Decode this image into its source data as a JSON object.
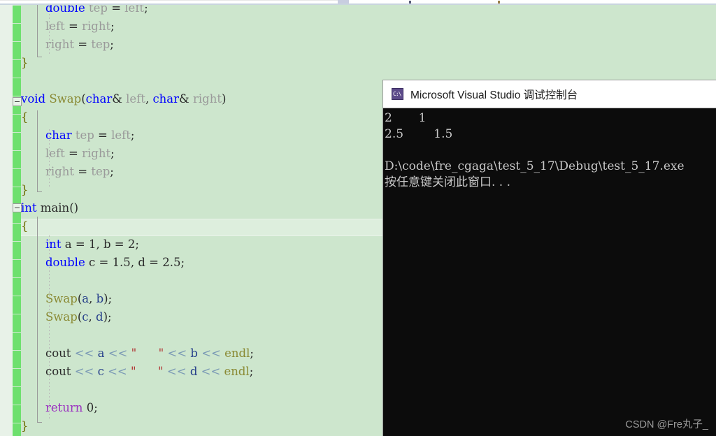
{
  "window": {
    "editor": {
      "background_color": "#cde6cd",
      "change_bar_color": "#6ee06e",
      "current_line_background": "#ddeedd"
    },
    "code_lines": [
      {
        "indent": 2,
        "tokens": [
          {
            "t": "double",
            "c": "typ"
          },
          {
            "t": " ",
            "c": "id"
          },
          {
            "t": "tep",
            "c": "var"
          },
          {
            "t": " ",
            "c": "id"
          },
          {
            "t": "=",
            "c": "pun"
          },
          {
            "t": " ",
            "c": "id"
          },
          {
            "t": "left",
            "c": "var"
          },
          {
            "t": ";",
            "c": "pun"
          }
        ]
      },
      {
        "indent": 2,
        "tokens": [
          {
            "t": "left",
            "c": "var"
          },
          {
            "t": " = ",
            "c": "pun"
          },
          {
            "t": "right",
            "c": "var"
          },
          {
            "t": ";",
            "c": "pun"
          }
        ]
      },
      {
        "indent": 2,
        "tokens": [
          {
            "t": "right",
            "c": "var"
          },
          {
            "t": " = ",
            "c": "pun"
          },
          {
            "t": "tep",
            "c": "var"
          },
          {
            "t": ";",
            "c": "pun"
          }
        ]
      },
      {
        "indent": 0,
        "tokens": [
          {
            "t": "}",
            "c": "brace"
          }
        ]
      },
      {
        "indent": 0,
        "tokens": []
      },
      {
        "indent": 0,
        "tokens": [
          {
            "t": "void",
            "c": "kw"
          },
          {
            "t": " ",
            "c": "id"
          },
          {
            "t": "Swap",
            "c": "fn"
          },
          {
            "t": "(",
            "c": "pun"
          },
          {
            "t": "char",
            "c": "typ"
          },
          {
            "t": "&",
            "c": "pun"
          },
          {
            "t": " ",
            "c": "id"
          },
          {
            "t": "left",
            "c": "var"
          },
          {
            "t": ", ",
            "c": "pun"
          },
          {
            "t": "char",
            "c": "typ"
          },
          {
            "t": "&",
            "c": "pun"
          },
          {
            "t": " ",
            "c": "id"
          },
          {
            "t": "right",
            "c": "var"
          },
          {
            "t": ")",
            "c": "pun"
          }
        ]
      },
      {
        "indent": 0,
        "tokens": [
          {
            "t": "{",
            "c": "brace"
          }
        ]
      },
      {
        "indent": 2,
        "tokens": [
          {
            "t": "char",
            "c": "typ"
          },
          {
            "t": " ",
            "c": "id"
          },
          {
            "t": "tep",
            "c": "var"
          },
          {
            "t": " = ",
            "c": "pun"
          },
          {
            "t": "left",
            "c": "var"
          },
          {
            "t": ";",
            "c": "pun"
          }
        ]
      },
      {
        "indent": 2,
        "tokens": [
          {
            "t": "left",
            "c": "var"
          },
          {
            "t": " = ",
            "c": "pun"
          },
          {
            "t": "right",
            "c": "var"
          },
          {
            "t": ";",
            "c": "pun"
          }
        ]
      },
      {
        "indent": 2,
        "tokens": [
          {
            "t": "right",
            "c": "var"
          },
          {
            "t": " = ",
            "c": "pun"
          },
          {
            "t": "tep",
            "c": "var"
          },
          {
            "t": ";",
            "c": "pun"
          }
        ]
      },
      {
        "indent": 0,
        "tokens": [
          {
            "t": "}",
            "c": "brace"
          }
        ]
      },
      {
        "indent": 0,
        "tokens": [
          {
            "t": "int",
            "c": "kw"
          },
          {
            "t": " ",
            "c": "id"
          },
          {
            "t": "main",
            "c": "id"
          },
          {
            "t": "()",
            "c": "pun"
          }
        ]
      },
      {
        "indent": 0,
        "tokens": [
          {
            "t": "{",
            "c": "brace"
          }
        ]
      },
      {
        "indent": 2,
        "tokens": [
          {
            "t": "int",
            "c": "typ"
          },
          {
            "t": " ",
            "c": "id"
          },
          {
            "t": "a",
            "c": "id"
          },
          {
            "t": " = ",
            "c": "pun"
          },
          {
            "t": "1",
            "c": "num"
          },
          {
            "t": ", ",
            "c": "pun"
          },
          {
            "t": "b",
            "c": "id"
          },
          {
            "t": " = ",
            "c": "pun"
          },
          {
            "t": "2",
            "c": "num"
          },
          {
            "t": ";",
            "c": "pun"
          }
        ]
      },
      {
        "indent": 2,
        "tokens": [
          {
            "t": "double",
            "c": "typ"
          },
          {
            "t": " ",
            "c": "id"
          },
          {
            "t": "c",
            "c": "id"
          },
          {
            "t": " = ",
            "c": "pun"
          },
          {
            "t": "1.5",
            "c": "num"
          },
          {
            "t": ", ",
            "c": "pun"
          },
          {
            "t": "d",
            "c": "id"
          },
          {
            "t": " = ",
            "c": "pun"
          },
          {
            "t": "2.5",
            "c": "num"
          },
          {
            "t": ";",
            "c": "pun"
          }
        ]
      },
      {
        "indent": 0,
        "tokens": []
      },
      {
        "indent": 2,
        "tokens": [
          {
            "t": "Swap",
            "c": "fn"
          },
          {
            "t": "(",
            "c": "pun"
          },
          {
            "t": "a",
            "c": "varb"
          },
          {
            "t": ", ",
            "c": "pun"
          },
          {
            "t": "b",
            "c": "varb"
          },
          {
            "t": ");",
            "c": "pun"
          }
        ]
      },
      {
        "indent": 2,
        "tokens": [
          {
            "t": "Swap",
            "c": "fn"
          },
          {
            "t": "(",
            "c": "pun"
          },
          {
            "t": "c",
            "c": "varb"
          },
          {
            "t": ", ",
            "c": "pun"
          },
          {
            "t": "d",
            "c": "varb"
          },
          {
            "t": ");",
            "c": "pun"
          }
        ]
      },
      {
        "indent": 0,
        "tokens": []
      },
      {
        "indent": 2,
        "tokens": [
          {
            "t": "cout",
            "c": "id"
          },
          {
            "t": " ",
            "c": "id"
          },
          {
            "t": "<<",
            "c": "op"
          },
          {
            "t": " ",
            "c": "id"
          },
          {
            "t": "a",
            "c": "varb"
          },
          {
            "t": " ",
            "c": "id"
          },
          {
            "t": "<<",
            "c": "op"
          },
          {
            "t": " ",
            "c": "id"
          },
          {
            "t": "\"      \"",
            "c": "str"
          },
          {
            "t": " ",
            "c": "id"
          },
          {
            "t": "<<",
            "c": "op"
          },
          {
            "t": " ",
            "c": "id"
          },
          {
            "t": "b",
            "c": "varb"
          },
          {
            "t": " ",
            "c": "id"
          },
          {
            "t": "<<",
            "c": "op"
          },
          {
            "t": " ",
            "c": "id"
          },
          {
            "t": "endl",
            "c": "fn"
          },
          {
            "t": ";",
            "c": "pun"
          }
        ]
      },
      {
        "indent": 2,
        "tokens": [
          {
            "t": "cout",
            "c": "id"
          },
          {
            "t": " ",
            "c": "id"
          },
          {
            "t": "<<",
            "c": "op"
          },
          {
            "t": " ",
            "c": "id"
          },
          {
            "t": "c",
            "c": "varb"
          },
          {
            "t": " ",
            "c": "id"
          },
          {
            "t": "<<",
            "c": "op"
          },
          {
            "t": " ",
            "c": "id"
          },
          {
            "t": "\"      \"",
            "c": "str"
          },
          {
            "t": " ",
            "c": "id"
          },
          {
            "t": "<<",
            "c": "op"
          },
          {
            "t": " ",
            "c": "id"
          },
          {
            "t": "d",
            "c": "varb"
          },
          {
            "t": " ",
            "c": "id"
          },
          {
            "t": "<<",
            "c": "op"
          },
          {
            "t": " ",
            "c": "id"
          },
          {
            "t": "endl",
            "c": "fn"
          },
          {
            "t": ";",
            "c": "pun"
          }
        ]
      },
      {
        "indent": 0,
        "tokens": []
      },
      {
        "indent": 2,
        "tokens": [
          {
            "t": "return",
            "c": "ret"
          },
          {
            "t": " ",
            "c": "id"
          },
          {
            "t": "0",
            "c": "num"
          },
          {
            "t": ";",
            "c": "pun"
          }
        ]
      },
      {
        "indent": 0,
        "tokens": [
          {
            "t": "}",
            "c": "brace"
          }
        ]
      }
    ]
  },
  "console": {
    "title": "Microsoft Visual Studio 调试控制台",
    "icon": "console-window-icon",
    "output_lines": [
      "2       1",
      "2.5        1.5",
      "",
      "D:\\code\\fre_cgaga\\test_5_17\\Debug\\test_5_17.exe",
      "按任意键关闭此窗口. . ."
    ],
    "background_color": "#0c0c0c",
    "text_color": "#c8c8c8"
  },
  "watermark": {
    "text": "CSDN @Fre丸子_"
  }
}
